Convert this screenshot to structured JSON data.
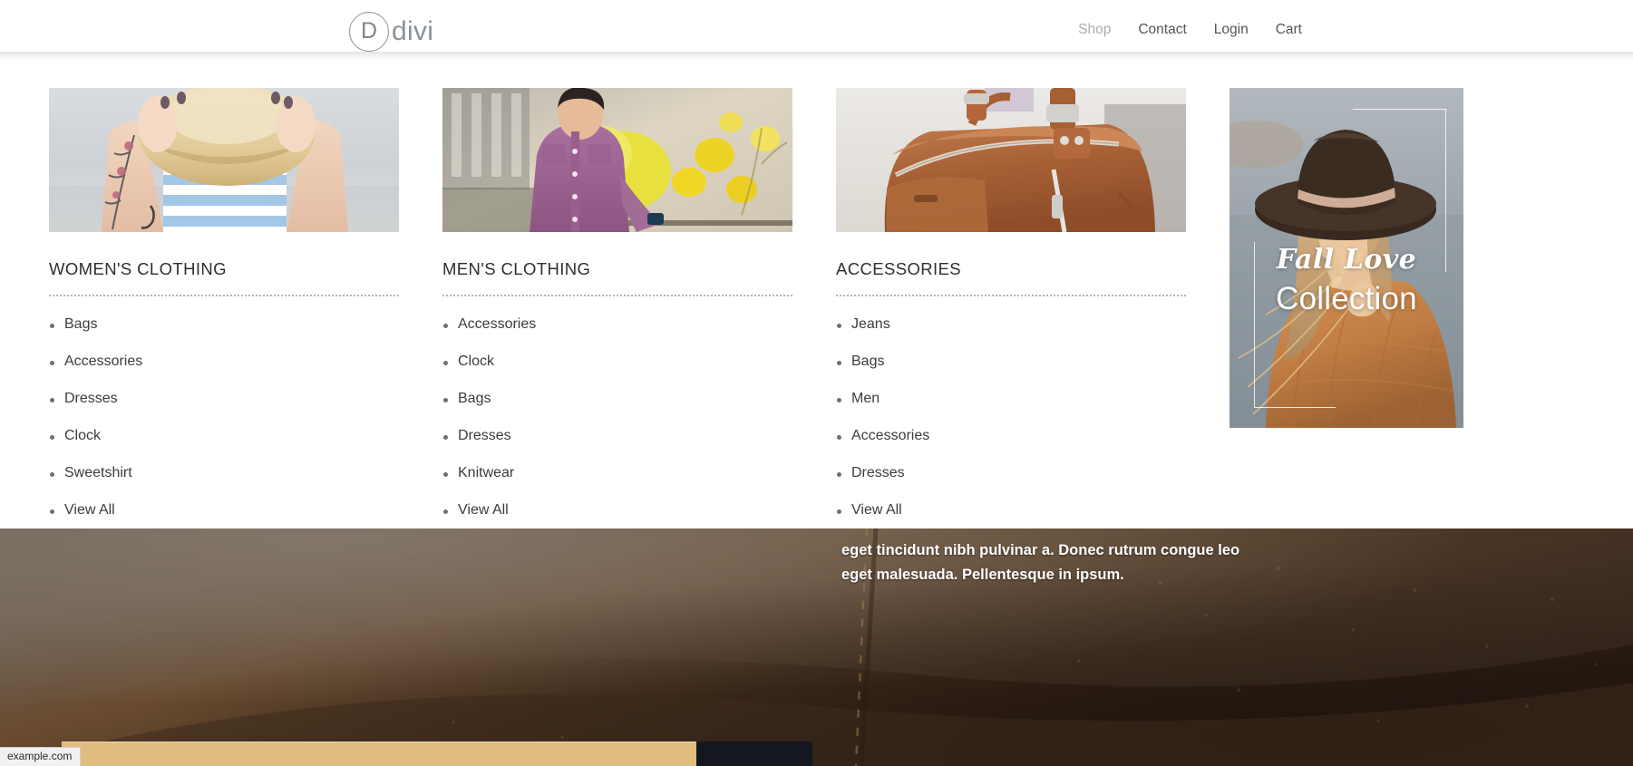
{
  "header": {
    "logo": {
      "mark_letter": "D",
      "wordmark": "divi",
      "icon": "divi-circle-logo"
    },
    "nav": [
      {
        "label": "Shop",
        "active": true
      },
      {
        "label": "Contact",
        "active": false
      },
      {
        "label": "Login",
        "active": false
      },
      {
        "label": "Cart",
        "active": false
      }
    ]
  },
  "mega_menu": {
    "columns": [
      {
        "title": "WOMEN'S CLOTHING",
        "thumb_alt": "woman in blue striped top holding straw hat",
        "items": [
          "Bags",
          "Accessories",
          "Dresses",
          "Clock",
          "Sweetshirt",
          "View All"
        ]
      },
      {
        "title": "MEN'S CLOTHING",
        "thumb_alt": "man in purple shirt beside yellow flowers",
        "items": [
          "Accessories",
          "Clock",
          "Bags",
          "Dresses",
          "Knitwear",
          "View All"
        ]
      },
      {
        "title": "ACCESSORIES",
        "thumb_alt": "brown leather duffel bag",
        "items": [
          "Jeans",
          "Bags",
          "Men",
          "Accessories",
          "Dresses",
          "View All"
        ]
      }
    ],
    "promo": {
      "script_line": "Fall Love",
      "sub_line": "Collection",
      "image_alt": "woman in wide brim hat and tan knit sweater"
    }
  },
  "hero": {
    "paragraph": "eget tincidunt nibh pulvinar a. Donec rutrum congue leo eget malesuada. Pellentesque in ipsum.",
    "background_alt": "close up of brown stitched leather"
  },
  "browser": {
    "status_url": "example.com"
  },
  "colors": {
    "accent_gold": "#e0bc7f",
    "dark_navy": "#141620",
    "nav_text": "#51565b",
    "nav_active": "#a9adb1",
    "logo_gray": "#8b9197"
  }
}
